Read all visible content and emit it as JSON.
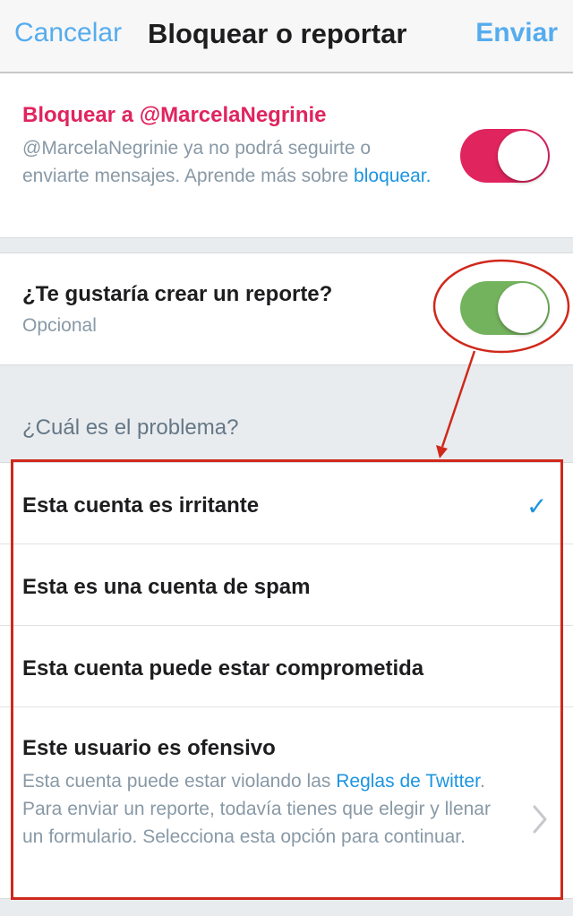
{
  "navbar": {
    "cancel_label": "Cancelar",
    "title": "Bloquear o reportar",
    "send_label": "Enviar"
  },
  "block": {
    "title": "Bloquear a @MarcelaNegrinie",
    "description": "@MarcelaNegrinie ya no podrá seguirte o enviarte mensajes. Aprende más sobre ",
    "link_text": "bloquear.",
    "toggle_on": true
  },
  "report": {
    "title": "¿Te gustaría crear un reporte?",
    "subtitle": "Opcional",
    "toggle_on": true
  },
  "problem": {
    "question": "¿Cuál es el problema?",
    "options": [
      {
        "label": "Esta cuenta es irritante",
        "selected": true
      },
      {
        "label": "Esta es una cuenta de spam",
        "selected": false
      },
      {
        "label": "Esta cuenta puede estar comprometida",
        "selected": false
      },
      {
        "label": "Este usuario es ofensivo",
        "selected": false,
        "desc_before": "Esta cuenta puede estar violando las ",
        "desc_link": "Reglas de Twitter",
        "desc_after": ". Para enviar un reporte, todavía tienes que elegir y llenar un formulario. Selecciona esta opción para continuar."
      }
    ]
  },
  "colors": {
    "accent": "#55acee",
    "link": "#1b95e0",
    "block_red": "#e0245e",
    "toggle_green": "#74b35e",
    "annotation_red": "#d0281b"
  },
  "icons": {
    "selected": "checkmark-icon",
    "more": "chevron-right-icon"
  }
}
